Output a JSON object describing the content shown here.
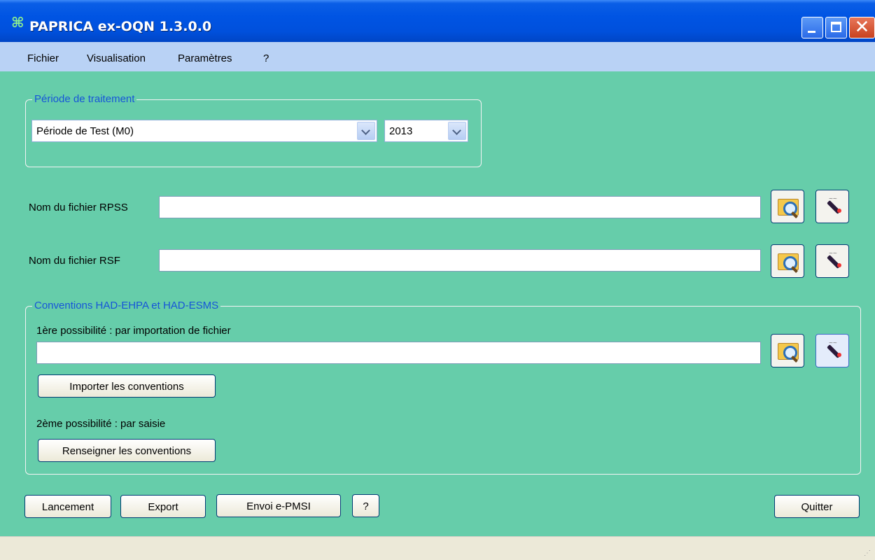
{
  "window": {
    "title": "PAPRICA ex-OQN 1.3.0.0"
  },
  "menu": [
    {
      "label": "Fichier"
    },
    {
      "label": "Visualisation"
    },
    {
      "label": "Paramètres"
    },
    {
      "label": "?"
    }
  ],
  "periode": {
    "legend": "Période de traitement",
    "period_value": "Période de Test (M0)",
    "year_value": "2013"
  },
  "rpss": {
    "label": "Nom du fichier RPSS",
    "value": ""
  },
  "rsf": {
    "label": "Nom du fichier RSF",
    "value": ""
  },
  "conventions": {
    "legend": "Conventions HAD-EHPA et HAD-ESMS",
    "option1_label": "1ère possibilité : par importation de fichier",
    "file_value": "",
    "import_button": "Importer les conventions",
    "option2_label": "2ème possibilité : par saisie",
    "fill_button": "Renseigner les conventions"
  },
  "actions": {
    "launch": "Lancement",
    "export": "Export",
    "send": "Envoi e-PMSI",
    "help": "?",
    "quit": "Quitter"
  },
  "colors": {
    "window_bg": "#66cdaa",
    "legend_text": "#1655d8",
    "titlebar": "#0054e3",
    "menubar": "#b9d2f5"
  },
  "icons": {
    "app": "app-logo-icon",
    "browse": "folder-search-icon",
    "clear": "magic-wand-clear-icon"
  }
}
